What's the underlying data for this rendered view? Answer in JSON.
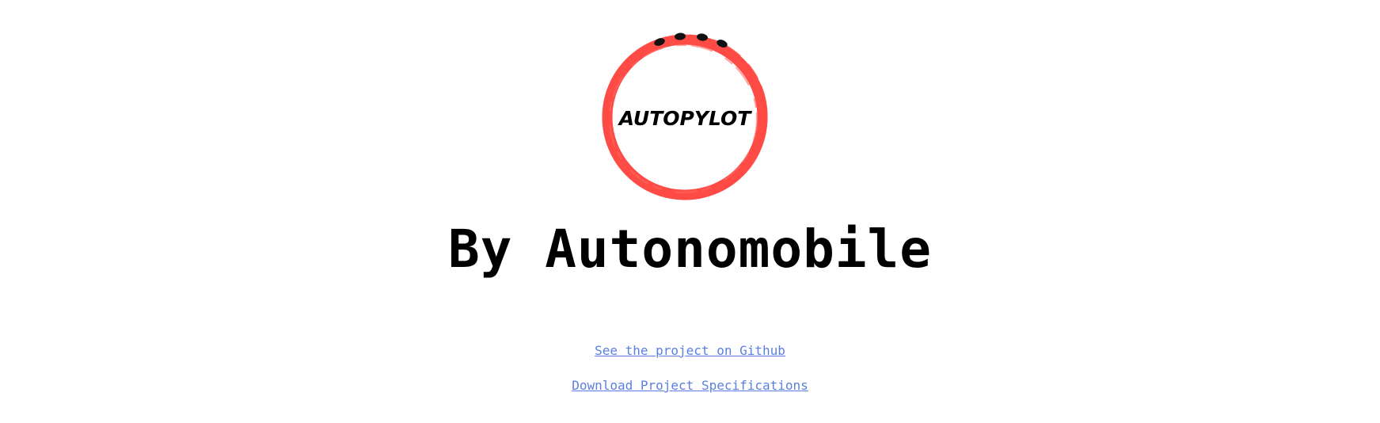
{
  "logo": {
    "text": "AUTOPYLOT",
    "ring_color": "#ff4b45",
    "dot_color": "#111111"
  },
  "heading": {
    "text": "By Autonomobile"
  },
  "links": {
    "github": "See the project on Github",
    "specs": "Download Project Specifications",
    "color": "#5a7fe0"
  }
}
